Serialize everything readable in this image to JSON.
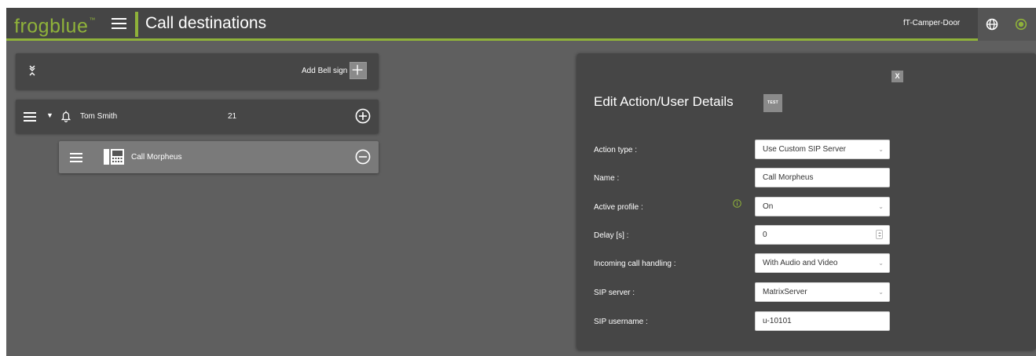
{
  "header": {
    "logo": "frogblue",
    "logo_tm": "™",
    "title": "Call destinations",
    "device_name": "fT-Camper-Door",
    "accent_color": "#8fb23a",
    "icons": [
      "menu-icon",
      "globe-icon",
      "power-icon"
    ]
  },
  "list": {
    "add_bell_label": "Add Bell sign",
    "bell_entry": {
      "name": "Tom Smith",
      "number": "21"
    },
    "action_entry": {
      "label": "Call Morpheus"
    },
    "icons": [
      "collapse-icon",
      "plus-icon",
      "menu-icon",
      "caret-down-icon",
      "bell-icon",
      "plus-circle-icon",
      "phone-icon",
      "minus-circle-icon"
    ]
  },
  "edit_panel": {
    "title": "Edit Action/User Details",
    "close_label": "X",
    "test_label": "TEST",
    "fields": {
      "action_type": {
        "label": "Action type :",
        "value": "Use Custom SIP Server"
      },
      "name": {
        "label": "Name :",
        "value": "Call Morpheus"
      },
      "active_profile": {
        "label": "Active profile :",
        "value": "On"
      },
      "delay": {
        "label": "Delay [s] :",
        "value": "0"
      },
      "incoming_call": {
        "label": "Incoming call handling :",
        "value": "With Audio and Video"
      },
      "sip_server": {
        "label": "SIP server :",
        "value": "MatrixServer"
      },
      "sip_username": {
        "label": "SIP username :",
        "value": "u-10101"
      }
    },
    "chevron_glyph": "⌄"
  }
}
